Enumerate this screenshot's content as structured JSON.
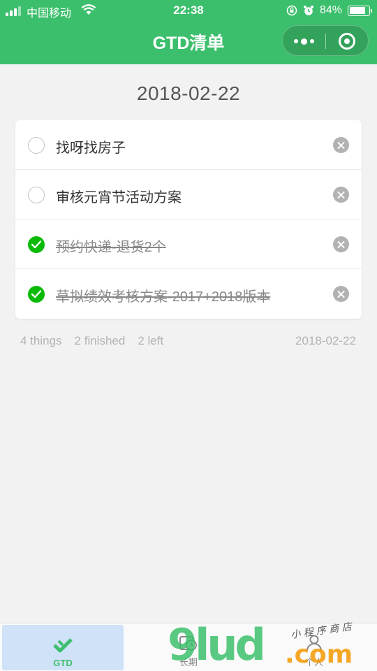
{
  "status_bar": {
    "carrier": "中国移动",
    "time": "22:38",
    "battery": "84%",
    "battery_level": 0.84
  },
  "nav": {
    "title": "GTD清单",
    "more_icon": "more-dots-icon",
    "close_icon": "target-circle-icon"
  },
  "main": {
    "date": "2018-02-22",
    "tasks": [
      {
        "text": "找呀找房子",
        "done": false
      },
      {
        "text": "审核元宵节活动方案",
        "done": false
      },
      {
        "text": "预约快递-退货2个",
        "done": true
      },
      {
        "text": "草拟绩效考核方案-2017+2018版本",
        "done": true
      }
    ],
    "stats": {
      "total": "4 things",
      "finished": "2 finished",
      "left": "2 left"
    },
    "footer_date": "2018-02-22"
  },
  "tabbar": {
    "tabs": [
      {
        "label": "GTD",
        "icon": "gtd-check-icon",
        "active": true
      },
      {
        "label": "长期",
        "icon": "calendar-clock-icon",
        "active": false
      },
      {
        "label": "个人",
        "icon": "person-icon",
        "active": false
      }
    ]
  },
  "watermark": {
    "brand": "9lud",
    "suffix": ".com",
    "tagline": "小 程 序 商 店"
  },
  "colors": {
    "brand_green": "#3cbf6c",
    "check_green": "#09bb07",
    "background": "#f2f2f2"
  }
}
